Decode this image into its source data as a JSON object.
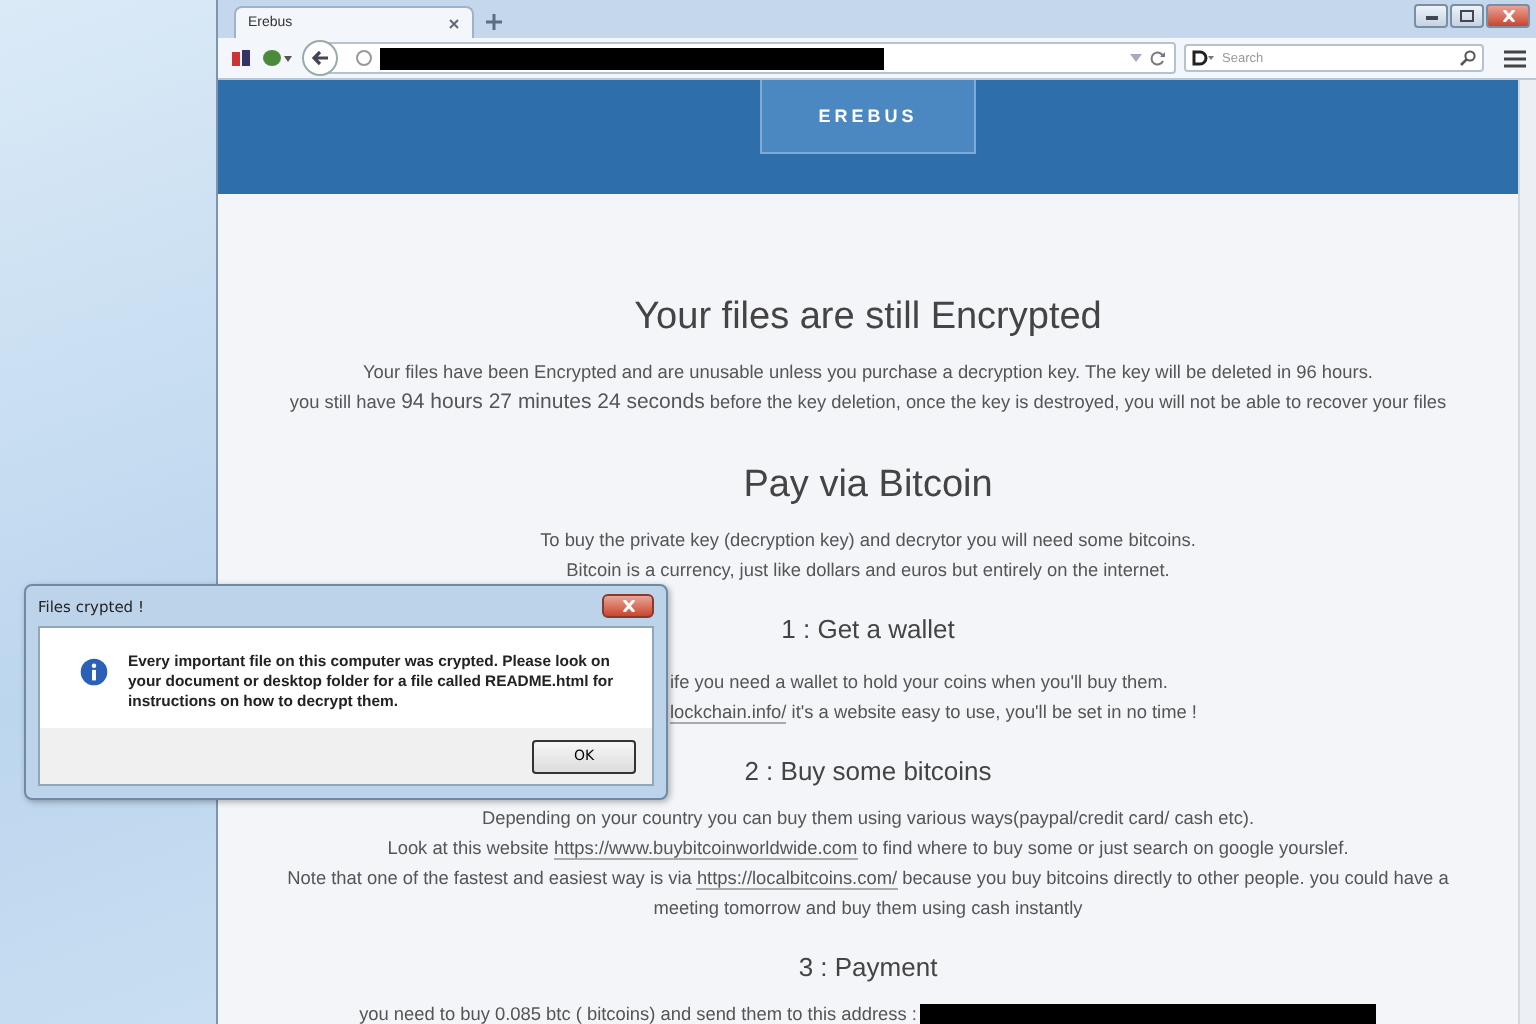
{
  "browser": {
    "tab": {
      "title": "Erebus",
      "selected": true
    },
    "url_redacted": true,
    "search": {
      "placeholder": "Search"
    }
  },
  "page": {
    "logo": "EREBUS",
    "content": [
      {
        "kind": "heading",
        "text": "Your files are still Encrypted"
      },
      {
        "kind": "paragraph",
        "lines": [
          [
            {
              "kind": "text",
              "text": "Your files have been Encrypted and are unusable unless you purchase a decryption key. The key will be deleted in 96 hours."
            }
          ],
          [
            {
              "kind": "text",
              "text": "you still have "
            },
            {
              "kind": "emph",
              "text": "94 hours 27 minutes 24 seconds"
            },
            {
              "kind": "text",
              "text": " before the key deletion, once the key is destroyed, you will not be able to recover your files"
            }
          ]
        ]
      },
      {
        "kind": "heading",
        "text": "Pay via Bitcoin"
      },
      {
        "kind": "paragraph",
        "lines": [
          [
            {
              "kind": "text",
              "text": "To buy the private key (decryption key) and decrytor you will need some bitcoins."
            }
          ],
          [
            {
              "kind": "text",
              "text": "Bitcoin is a currency, just like dollars and euros but entirely on the internet."
            }
          ]
        ]
      },
      {
        "kind": "subheading",
        "text": "1 : Get a wallet"
      },
      {
        "kind": "partial",
        "lines": [
          [
            {
              "kind": "text",
              "text": "ife you need a wallet to hold your coins when you'll buy them."
            }
          ],
          [
            {
              "kind": "link",
              "text": "lockchain.info/"
            },
            {
              "kind": "text",
              "text": " it's a website easy to use, you'll be set in no time !"
            }
          ]
        ]
      },
      {
        "kind": "subheading",
        "text": "2 : Buy some bitcoins"
      },
      {
        "kind": "paragraph",
        "lines": [
          [
            {
              "kind": "text",
              "text": "Depending on your country you can buy them using various ways(paypal/credit card/ cash etc)."
            }
          ],
          [
            {
              "kind": "text",
              "text": "Look at this website "
            },
            {
              "kind": "link",
              "text": "https://www.buybitcoinworldwide.com"
            },
            {
              "kind": "text",
              "text": " to find where to buy some or just search on google yourslef."
            }
          ],
          [
            {
              "kind": "text",
              "text": "Note that one of the fastest and easiest way is via "
            },
            {
              "kind": "link",
              "text": "https://localbitcoins.com/"
            },
            {
              "kind": "text",
              "text": " because you buy bitcoins directly to other people. you could have a"
            }
          ],
          [
            {
              "kind": "text",
              "text": "meeting tomorrow and buy them using cash instantly"
            }
          ]
        ]
      },
      {
        "kind": "subheading",
        "text": "3 : Payment"
      },
      {
        "kind": "paragraph",
        "redacted": true,
        "lines": [
          [
            {
              "kind": "text",
              "text": "you need to buy 0.085 btc ( bitcoins) and send them to this address :"
            }
          ]
        ]
      }
    ]
  },
  "dialog": {
    "title": "Files crypted !",
    "message": "Every important file on this computer was crypted. Please look on your document or desktop folder for a file called README.html for instructions on how to decrypt them.",
    "button": "OK"
  }
}
